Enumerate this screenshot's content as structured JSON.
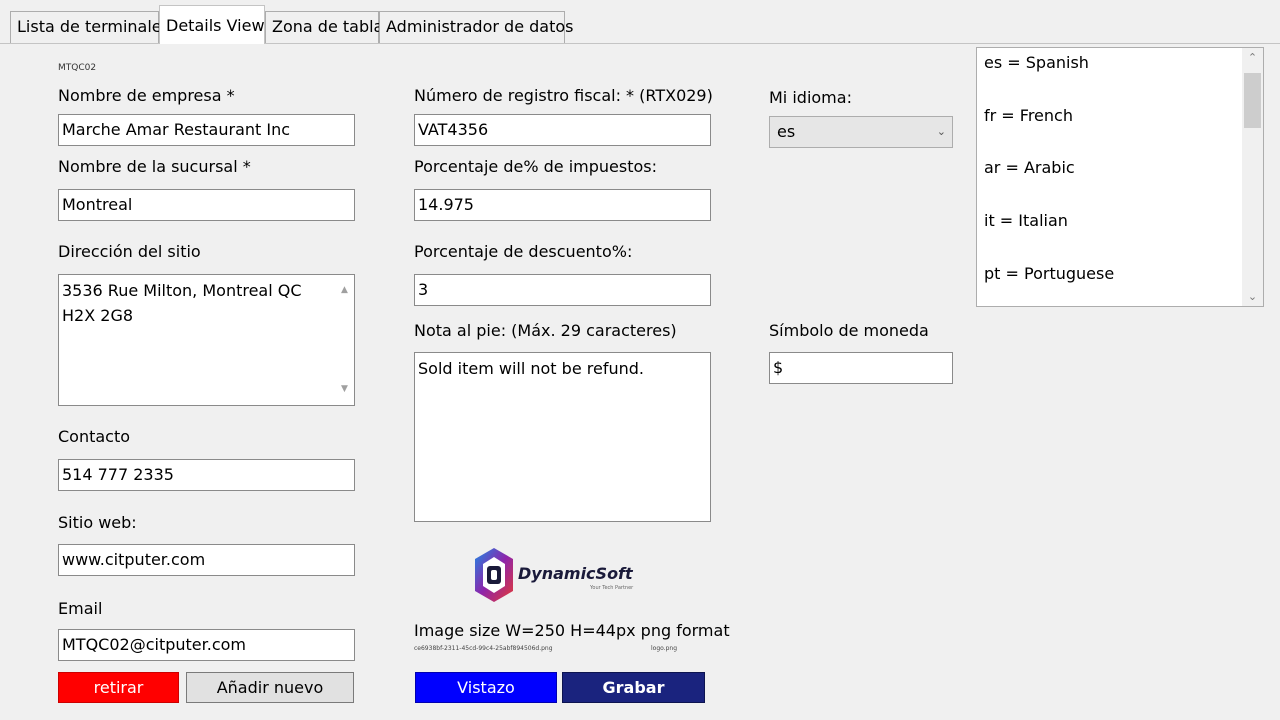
{
  "tabs": [
    {
      "label": "Lista de terminales"
    },
    {
      "label": "Details View"
    },
    {
      "label": "Zona de tabla"
    },
    {
      "label": "Administrador de datos"
    }
  ],
  "active_tab": "Details View",
  "form": {
    "code": "MTQC02",
    "company_name": {
      "label": "Nombre de empresa *",
      "value": "Marche Amar Restaurant Inc"
    },
    "branch_name": {
      "label": "Nombre de la sucursal *",
      "value": "Montreal"
    },
    "address": {
      "label": "Dirección del sitio",
      "value": "3536 Rue Milton, Montreal QC H2X 2G8"
    },
    "contact": {
      "label": "Contacto",
      "value": "514 777 2335"
    },
    "website": {
      "label": "Sitio web:",
      "value": "www.citputer.com"
    },
    "email": {
      "label": "Email",
      "value": "MTQC02@citputer.com"
    },
    "tax_number": {
      "label": "Número de registro fiscal: * (RTX029)",
      "value": "VAT4356"
    },
    "tax_percent": {
      "label": "Porcentaje de% de impuestos:",
      "value": "14.975"
    },
    "discount_percent": {
      "label": "Porcentaje de descuento%:",
      "value": "3"
    },
    "footer_note": {
      "label": "Nota al pie: (Máx. 29 caracteres)",
      "value": "Sold item will not be refund."
    },
    "language": {
      "label": "Mi idioma:",
      "value": "es"
    },
    "currency_symbol": {
      "label": "Símbolo de moneda",
      "value": "$"
    }
  },
  "language_list": [
    "es = Spanish",
    "fr = French",
    "ar = Arabic",
    "it = Italian",
    "pt = Portuguese"
  ],
  "logo": {
    "name": "DynamicSoft",
    "tagline": "Your Tech Partner",
    "image_size_text": "Image size W=250 H=44px png format",
    "file_id": "ce6938bf-2311-45cd-99c4-25abf894506d.png",
    "file_name": "logo.png"
  },
  "buttons": {
    "remove": "retirar",
    "add_new": "Añadir nuevo",
    "preview": "Vistazo",
    "save": "Grabar"
  },
  "colors": {
    "remove_button": "#ff0000",
    "preview_button": "#0000ff",
    "save_button": "#1a237e"
  },
  "icons": {
    "combo_arrow": "chevron-down-icon",
    "scroll_up": "scroll-up-icon",
    "scroll_down": "scroll-down-icon"
  }
}
